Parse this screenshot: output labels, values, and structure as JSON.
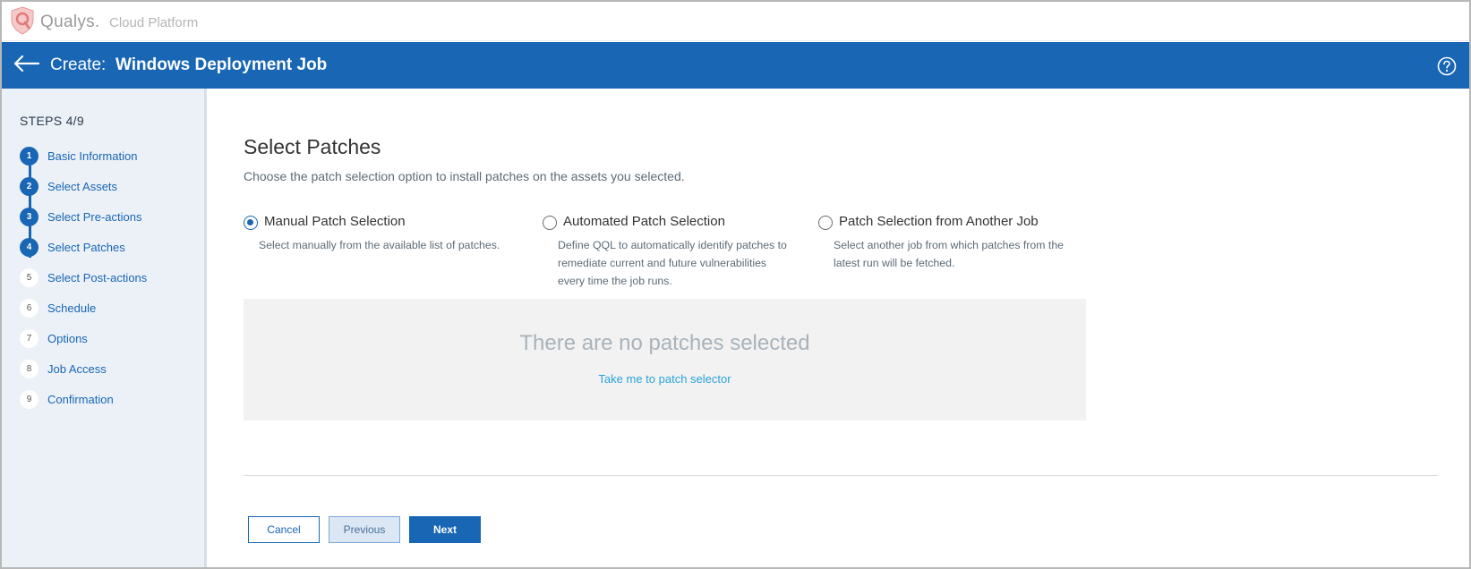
{
  "brand": {
    "name": "Qualys.",
    "subtitle": "Cloud Platform"
  },
  "header": {
    "prefix": "Create:",
    "title": "Windows Deployment Job"
  },
  "sidebar": {
    "steps_count": "STEPS 4/9",
    "steps": [
      {
        "num": "1",
        "label": "Basic Information",
        "completed": true
      },
      {
        "num": "2",
        "label": "Select Assets",
        "completed": true
      },
      {
        "num": "3",
        "label": "Select Pre-actions",
        "completed": true
      },
      {
        "num": "4",
        "label": "Select Patches",
        "completed": true
      },
      {
        "num": "5",
        "label": "Select Post-actions",
        "completed": false
      },
      {
        "num": "6",
        "label": "Schedule",
        "completed": false
      },
      {
        "num": "7",
        "label": "Options",
        "completed": false
      },
      {
        "num": "8",
        "label": "Job Access",
        "completed": false
      },
      {
        "num": "9",
        "label": "Confirmation",
        "completed": false
      }
    ]
  },
  "main": {
    "title": "Select Patches",
    "description": "Choose the patch selection option to install patches on the assets you selected.",
    "options": [
      {
        "title": "Manual Patch Selection",
        "desc": "Select manually from the available list of patches.",
        "selected": true
      },
      {
        "title": "Automated Patch Selection",
        "desc_lines": [
          "Define QQL to automatically identify patches to",
          "remediate current and future vulnerabilities",
          "every time the job runs."
        ],
        "selected": false
      },
      {
        "title": "Patch Selection from Another Job",
        "desc_lines": [
          "Select another job from which patches from the",
          "latest run will be fetched."
        ],
        "selected": false
      }
    ],
    "empty_state": {
      "message": "There are no patches selected",
      "link": "Take me to patch selector"
    }
  },
  "footer": {
    "cancel_label": "Cancel",
    "previous_label": "Previous",
    "next_label": "Next"
  },
  "colors": {
    "primary": "#1866b4",
    "sidebar_bg": "#ecf1f8",
    "link": "#2aa3d9"
  }
}
